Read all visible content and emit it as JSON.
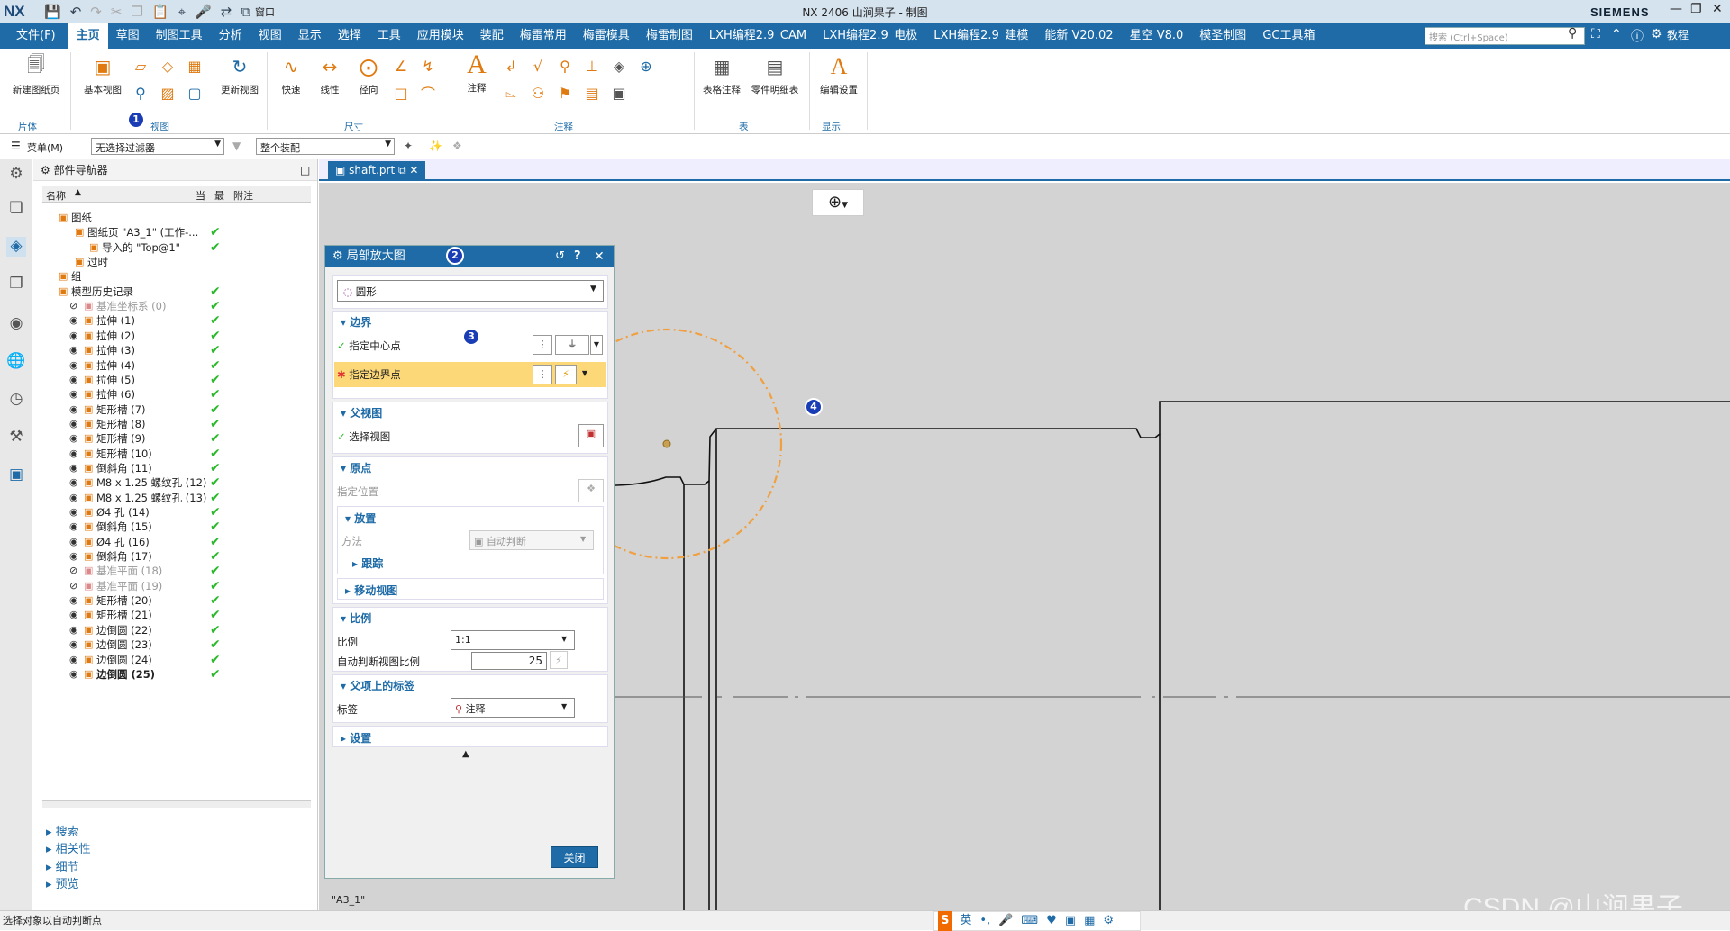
{
  "titlebar": {
    "logo": "NX",
    "window_menu": "窗口",
    "title": "NX 2406 山涧果子 - 制图",
    "brand": "SIEMENS"
  },
  "menubar": {
    "items": [
      "文件(F)",
      "主页",
      "草图",
      "制图工具",
      "分析",
      "视图",
      "显示",
      "选择",
      "工具",
      "应用模块",
      "装配",
      "梅雷常用",
      "梅雷模具",
      "梅雷制图",
      "LXH编程2.9_CAM",
      "LXH编程2.9_电极",
      "LXH编程2.9_建模",
      "能新 V20.02",
      "星空 V8.0",
      "模圣制图",
      "GC工具箱"
    ],
    "active_index": 1,
    "search_placeholder": "搜索 (Ctrl+Space)",
    "tutorial": "教程"
  },
  "ribbon": {
    "new_sheet": "新建图纸页",
    "group_sheet": "片体",
    "base_view": "基本视图",
    "update_view": "更新视图",
    "group_view": "视图",
    "quick": "快速",
    "linear": "线性",
    "radial": "径向",
    "group_dim": "尺寸",
    "note": "注释",
    "group_annotation": "注释",
    "table_note": "表格注释",
    "parts_list": "零件明细表",
    "group_table": "表",
    "edit_settings": "编辑设置",
    "group_display": "显示"
  },
  "toolbar2": {
    "menu": "菜单(M)",
    "filter": "无选择过滤器",
    "assembly": "整个装配"
  },
  "navigator": {
    "title": "部件导航器",
    "col_name": "名称",
    "col_current": "当",
    "col_latest": "最",
    "col_notes": "附注",
    "rows": [
      {
        "name": "图纸",
        "indent": 1,
        "check": false
      },
      {
        "name": "图纸页 \"A3_1\" (工作-...",
        "indent": 2,
        "check": true
      },
      {
        "name": "导入的 \"Top@1\"",
        "indent": 3,
        "check": true
      },
      {
        "name": "过时",
        "indent": 2,
        "check": false
      },
      {
        "name": "组",
        "indent": 1,
        "check": false
      },
      {
        "name": "模型历史记录",
        "indent": 1,
        "check": true
      },
      {
        "name": "基准坐标系 (0)",
        "indent": 2,
        "check": true,
        "gray": true
      },
      {
        "name": "拉伸 (1)",
        "indent": 2,
        "check": true
      },
      {
        "name": "拉伸 (2)",
        "indent": 2,
        "check": true
      },
      {
        "name": "拉伸 (3)",
        "indent": 2,
        "check": true
      },
      {
        "name": "拉伸 (4)",
        "indent": 2,
        "check": true
      },
      {
        "name": "拉伸 (5)",
        "indent": 2,
        "check": true
      },
      {
        "name": "拉伸 (6)",
        "indent": 2,
        "check": true
      },
      {
        "name": "矩形槽 (7)",
        "indent": 2,
        "check": true
      },
      {
        "name": "矩形槽 (8)",
        "indent": 2,
        "check": true
      },
      {
        "name": "矩形槽 (9)",
        "indent": 2,
        "check": true
      },
      {
        "name": "矩形槽 (10)",
        "indent": 2,
        "check": true
      },
      {
        "name": "倒斜角 (11)",
        "indent": 2,
        "check": true
      },
      {
        "name": "M8 x 1.25 螺纹孔 (12)",
        "indent": 2,
        "check": true
      },
      {
        "name": "M8 x 1.25 螺纹孔 (13)",
        "indent": 2,
        "check": true
      },
      {
        "name": "Ø4 孔 (14)",
        "indent": 2,
        "check": true
      },
      {
        "name": "倒斜角 (15)",
        "indent": 2,
        "check": true
      },
      {
        "name": "Ø4 孔 (16)",
        "indent": 2,
        "check": true
      },
      {
        "name": "倒斜角 (17)",
        "indent": 2,
        "check": true
      },
      {
        "name": "基准平面 (18)",
        "indent": 2,
        "check": true,
        "gray": true
      },
      {
        "name": "基准平面 (19)",
        "indent": 2,
        "check": true,
        "gray": true
      },
      {
        "name": "矩形槽 (20)",
        "indent": 2,
        "check": true
      },
      {
        "name": "矩形槽 (21)",
        "indent": 2,
        "check": true
      },
      {
        "name": "边倒圆 (22)",
        "indent": 2,
        "check": true
      },
      {
        "name": "边倒圆 (23)",
        "indent": 2,
        "check": true
      },
      {
        "name": "边倒圆 (24)",
        "indent": 2,
        "check": true
      },
      {
        "name": "边倒圆 (25)",
        "indent": 2,
        "check": true,
        "bold": true
      }
    ],
    "sections": [
      "搜索",
      "相关性",
      "细节",
      "预览"
    ]
  },
  "tab": {
    "label": "shaft.prt"
  },
  "dialog": {
    "title": "局部放大图",
    "type_value": "圆形",
    "sec_boundary": "边界",
    "specify_center": "指定中心点",
    "specify_boundary": "指定边界点",
    "sec_parent": "父视图",
    "select_view": "选择视图",
    "sec_origin": "原点",
    "specify_location": "指定位置",
    "sec_placement": "放置",
    "method_label": "方法",
    "method_value": "自动判断",
    "track": "跟踪",
    "move_view": "移动视图",
    "sec_scale": "比例",
    "scale_label": "比例",
    "scale_value": "1:1",
    "auto_scale_label": "自动判断视图比例",
    "auto_scale_value": "25",
    "sec_label": "父项上的标签",
    "label_label": "标签",
    "label_value": "注释",
    "sec_settings": "设置",
    "close": "关闭"
  },
  "canvas": {
    "sheet_name": "\"A3_1\""
  },
  "status": {
    "text": "选择对象以自动判断点",
    "ime": "英"
  },
  "watermark": "CSDN @山涧果子",
  "badges": [
    "1",
    "2",
    "3",
    "4"
  ],
  "colors": {
    "accent": "#1e6ba7",
    "highlight": "#fcd878",
    "check": "#2ab82a",
    "circle": "#f0a040"
  }
}
